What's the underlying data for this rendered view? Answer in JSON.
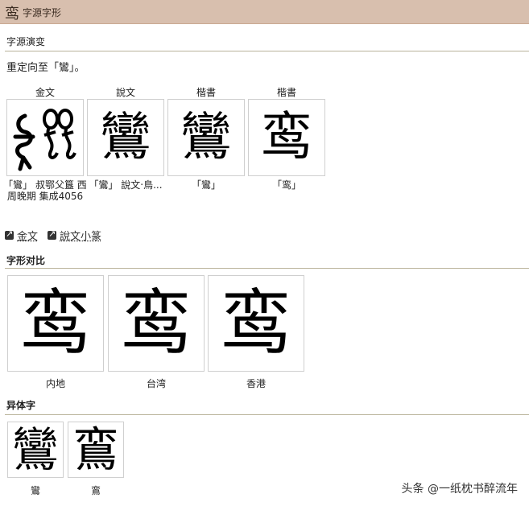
{
  "header": {
    "logo_char": "鸾",
    "title": "字源字形"
  },
  "evolution": {
    "label": "字源演变",
    "note": "重定向至「鸞」。",
    "columns": [
      {
        "head": "金文",
        "glyph": "",
        "caption": "「鸞」 叔鄂父簋 西周晚期 集成4056"
      },
      {
        "head": "說文",
        "glyph": "鸞",
        "caption": "「鸞」 說文‧鳥..."
      },
      {
        "head": "楷書",
        "glyph": "鸞",
        "caption": "「鸞」"
      },
      {
        "head": "楷書",
        "glyph": "鸾",
        "caption": "「鸾」"
      }
    ],
    "links": [
      "金文",
      "說文小篆"
    ]
  },
  "compare": {
    "label": "字形对比",
    "items": [
      {
        "glyph": "鸾",
        "caption": "内地"
      },
      {
        "glyph": "鸾",
        "caption": "台湾"
      },
      {
        "glyph": "鸾",
        "caption": "香港"
      }
    ]
  },
  "variants": {
    "label": "异体字",
    "items": [
      {
        "glyph": "鸞",
        "caption": "鸞"
      },
      {
        "glyph": "鵉",
        "caption": "鵉"
      }
    ]
  },
  "watermark": "头条 @一纸枕书醉流年"
}
